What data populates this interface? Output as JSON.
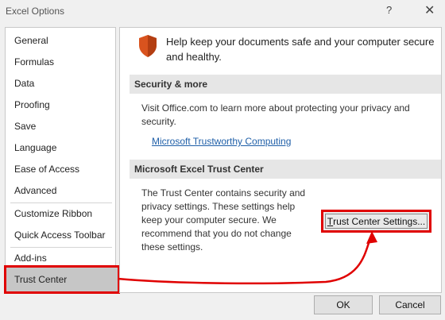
{
  "window": {
    "title": "Excel Options",
    "help_label": "?",
    "close_label": "✕"
  },
  "sidebar": {
    "items": [
      {
        "label": "General"
      },
      {
        "label": "Formulas"
      },
      {
        "label": "Data"
      },
      {
        "label": "Proofing"
      },
      {
        "label": "Save"
      },
      {
        "label": "Language"
      },
      {
        "label": "Ease of Access"
      },
      {
        "label": "Advanced"
      },
      {
        "label": "Customize Ribbon"
      },
      {
        "label": "Quick Access Toolbar"
      },
      {
        "label": "Add-ins"
      },
      {
        "label": "Trust Center",
        "selected": true
      }
    ]
  },
  "main": {
    "intro_icon": "shield-icon",
    "intro_text": "Help keep your documents safe and your computer secure and healthy.",
    "security": {
      "heading": "Security & more",
      "text": "Visit Office.com to learn more about protecting your privacy and security.",
      "link": "Microsoft Trustworthy Computing"
    },
    "trust_center": {
      "heading": "Microsoft Excel Trust Center",
      "text": "The Trust Center contains security and privacy settings. These settings help keep your computer secure. We recommend that you do not change these settings.",
      "button_accel": "T",
      "button_rest": "rust Center Settings..."
    }
  },
  "footer": {
    "ok_label": "OK",
    "cancel_label": "Cancel"
  },
  "colors": {
    "highlight_red": "#e00000",
    "selected_bg": "#c6c6c6",
    "shield_orange": "#d9531e",
    "link_blue": "#1f5fa8"
  }
}
